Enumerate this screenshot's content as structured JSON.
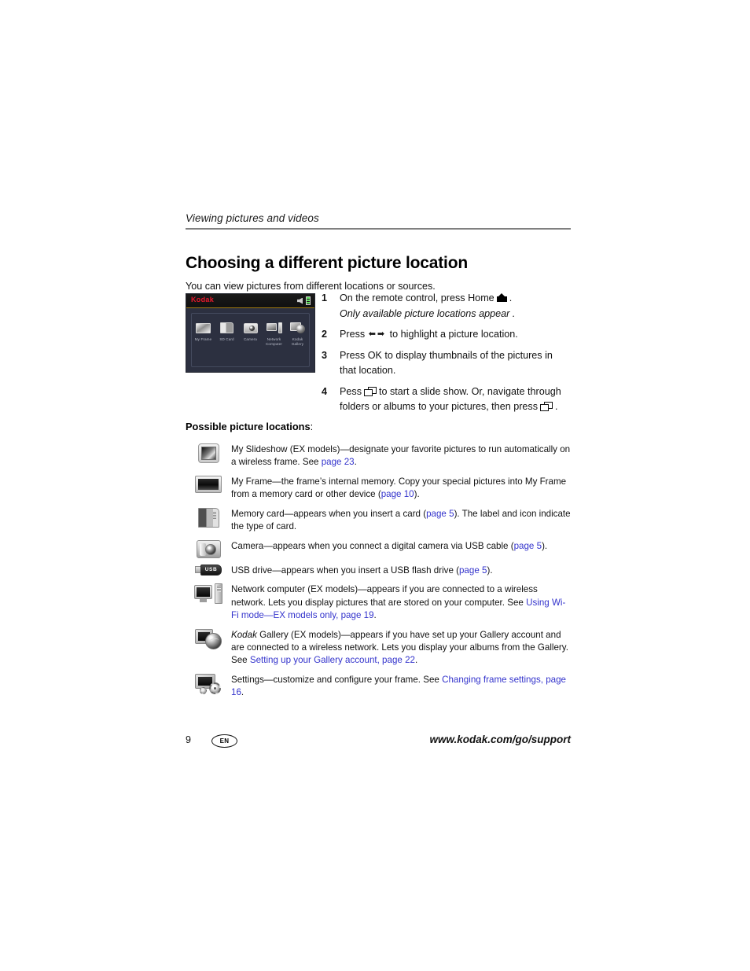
{
  "header": {
    "running_header": "Viewing pictures and videos"
  },
  "title": "Choosing a different picture location",
  "intro": "You can view pictures from different locations or sources.",
  "device_screenshot": {
    "logo": "Kodak",
    "icons": {
      "speaker": "speaker-icon",
      "battery": "battery-icon"
    },
    "tiles": [
      {
        "label": "My Frame",
        "icon": "frame-icon"
      },
      {
        "label": "SD Card",
        "icon": "memory-card-icon"
      },
      {
        "label": "Camera",
        "icon": "camera-icon"
      },
      {
        "label": "Network Computer",
        "icon": "network-computer-icon"
      },
      {
        "label": "Kodak Gallery",
        "icon": "kodak-gallery-icon"
      }
    ]
  },
  "steps": [
    {
      "num": "1",
      "text_before": "On the remote control, press Home",
      "icon": "home-icon",
      "text_after": ".",
      "subtext": "Only available picture locations appear ."
    },
    {
      "num": "2",
      "text_before": "Press",
      "icon": "left-right-arrows-icon",
      "arrows": "← →",
      "text_after": "to highlight a picture location."
    },
    {
      "num": "3",
      "text_before": "Press OK to display thumbnails of the pictures in that location."
    },
    {
      "num": "4",
      "text_before": "Pess",
      "icon": "slideshow-icon",
      "text_mid": "to start a slide show. Or, navigate through folders or albums to your pictures, then press",
      "text_after": "."
    }
  ],
  "section": {
    "heading": "Possible picture locations",
    "heading_colon": ":"
  },
  "locations": [
    {
      "icon": "my-slideshow-icon",
      "parts": [
        {
          "t": "My Slideshow (EX models)—designate your favorite pictures to run automatically on a wireless frame. See ",
          "style": "plain"
        },
        {
          "t": "page 23",
          "style": "link"
        },
        {
          "t": ".",
          "style": "plain"
        }
      ]
    },
    {
      "icon": "my-frame-icon",
      "parts": [
        {
          "t": "My Frame—the frame’s internal memory. Copy your special pictures into My Frame from a memory card or other device (",
          "style": "plain"
        },
        {
          "t": "page 10",
          "style": "link"
        },
        {
          "t": ").",
          "style": "plain"
        }
      ]
    },
    {
      "icon": "memory-card-icon",
      "parts": [
        {
          "t": "Memory card—appears when you insert a card (",
          "style": "plain"
        },
        {
          "t": "page 5",
          "style": "link"
        },
        {
          "t": "). The label and icon indicate the type of card.",
          "style": "plain"
        }
      ]
    },
    {
      "icon": "camera-icon",
      "parts": [
        {
          "t": "Camera—appears when you connect a digital camera via USB cable (",
          "style": "plain"
        },
        {
          "t": "page 5",
          "style": "link"
        },
        {
          "t": ").",
          "style": "plain"
        }
      ]
    },
    {
      "icon": "usb-drive-icon",
      "usb_label": "USB",
      "parts": [
        {
          "t": "USB drive—appears when you insert a USB flash drive (",
          "style": "plain"
        },
        {
          "t": "page 5",
          "style": "link"
        },
        {
          "t": ").",
          "style": "plain"
        }
      ]
    },
    {
      "icon": "network-computer-icon",
      "parts": [
        {
          "t": "Network computer (EX models)—appears if you are connected to a wireless network. Lets you display pictures that are stored on your computer. See ",
          "style": "plain"
        },
        {
          "t": "Using Wi-Fi mode—EX models only, page 19",
          "style": "link"
        },
        {
          "t": ".",
          "style": "plain"
        }
      ]
    },
    {
      "icon": "kodak-gallery-icon",
      "parts": [
        {
          "t": "Kodak",
          "style": "italic"
        },
        {
          "t": " Gallery (EX models)—appears if you have set up your Gallery account and are connected to a wireless network. Lets you display your albums from the Gallery. See ",
          "style": "plain"
        },
        {
          "t": "Setting up your Gallery account, page 22",
          "style": "link"
        },
        {
          "t": ".",
          "style": "plain"
        }
      ]
    },
    {
      "icon": "settings-icon",
      "parts": [
        {
          "t": "Settings—customize and configure your frame. See ",
          "style": "plain"
        },
        {
          "t": "Changing frame settings, page 16",
          "style": "link"
        },
        {
          "t": ".",
          "style": "plain"
        }
      ]
    }
  ],
  "footer": {
    "page_number": "9",
    "language": "EN",
    "support_url": "www.kodak.com/go/support"
  },
  "colors": {
    "link": "#3333cc",
    "rule": "#808080",
    "kodak_red": "#e8192c"
  }
}
